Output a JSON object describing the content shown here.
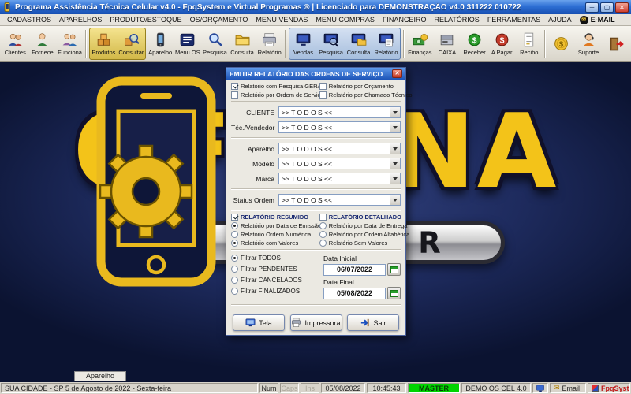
{
  "window": {
    "title": "Programa Assistência Técnica Celular v4.0 - FpqSystem e Virtual Programas ® | Licenciado para  DEMONSTRAÇÃO v4.0 311222 010722",
    "controls": {
      "minimize": "─",
      "maximize": "▢",
      "close": "✕"
    }
  },
  "menubar": {
    "items": [
      "CADASTROS",
      "APARELHOS",
      "PRODUTO/ESTOQUE",
      "OS/ORÇAMENTO",
      "MENU VENDAS",
      "MENU COMPRAS",
      "FINANCEIRO",
      "RELATÓRIOS",
      "FERRAMENTAS",
      "AJUDA"
    ],
    "email": {
      "label": "E-MAIL",
      "glyph": "✉"
    }
  },
  "toolbar": {
    "buttons": [
      {
        "label": "Clientes",
        "icon": "clients-icon"
      },
      {
        "label": "Fornece",
        "icon": "suppliers-icon"
      },
      {
        "label": "Funciona",
        "icon": "employees-icon"
      },
      {
        "label": "Produtos",
        "icon": "products-icon"
      },
      {
        "label": "Consultar",
        "icon": "products-search-icon"
      },
      {
        "label": "Aparelho",
        "icon": "device-icon"
      },
      {
        "label": "Menu OS",
        "icon": "service-orders-icon"
      },
      {
        "label": "Pesquisa",
        "icon": "os-search-icon"
      },
      {
        "label": "Consulta",
        "icon": "os-query-icon"
      },
      {
        "label": "Relatório",
        "icon": "os-report-icon"
      },
      {
        "label": "Vendas",
        "icon": "sales-icon"
      },
      {
        "label": "Pesquisa",
        "icon": "sales-search-icon"
      },
      {
        "label": "Consulta",
        "icon": "sales-query-icon"
      },
      {
        "label": "Relatório",
        "icon": "sales-report-icon"
      },
      {
        "label": "Finanças",
        "icon": "finance-icon"
      },
      {
        "label": "CAIXA",
        "icon": "cashbox-icon"
      },
      {
        "label": "Receber",
        "icon": "receivables-icon"
      },
      {
        "label": "A Pagar",
        "icon": "payables-icon"
      },
      {
        "label": "Recibo",
        "icon": "receipt-icon"
      },
      {
        "label": "",
        "icon": "coins-icon"
      },
      {
        "label": "Suporte",
        "icon": "support-icon"
      },
      {
        "label": "",
        "icon": "exit-icon"
      }
    ]
  },
  "brand": {
    "top": "OFICINA",
    "bottom": "CELULAR"
  },
  "floating_label": "Aparelho",
  "dialog": {
    "title": "EMITIR RELATÓRIO DAS ORDENS DE SERVIÇO",
    "close_glyph": "✕",
    "checkboxes": {
      "pesquisa_geral": {
        "label": "Relatório com Pesquisa GERAL",
        "checked": true
      },
      "por_orcamento": {
        "label": "Relatório por Orçamento",
        "checked": false
      },
      "por_ordem_servico": {
        "label": "Relatório por Ordem de Serviço",
        "checked": false
      },
      "por_chamado_tecnico": {
        "label": "Relatório por Chamado Técnico",
        "checked": false
      },
      "resumido": {
        "label": "RELATÓRIO RESUMIDO",
        "checked": true
      },
      "detalhado": {
        "label": "RELATÓRIO DETALHADO",
        "checked": false
      }
    },
    "selects": {
      "cliente": {
        "label": "CLIENTE",
        "value": ">> T O D O S <<"
      },
      "tecnico": {
        "label": "Téc./Vendedor",
        "value": ">> T O D O S <<"
      },
      "aparelho": {
        "label": "Aparelho",
        "value": ">> T O D O S <<"
      },
      "modelo": {
        "label": "Modelo",
        "value": ">> T O D O S <<"
      },
      "marca": {
        "label": "Marca",
        "value": ">> T O D O S <<"
      },
      "status_ordem": {
        "label": "Status Ordem",
        "value": ">> T O D O S <<"
      }
    },
    "radios": {
      "data_emissao": {
        "label": "Relatório por Data de Emissão",
        "selected": true
      },
      "data_entrega": {
        "label": "Relatório por Data de Entrega",
        "selected": false
      },
      "ordem_numerica": {
        "label": "Relatório Ordem Numérica",
        "selected": false
      },
      "ordem_alfabetica": {
        "label": "Relatório por Ordem Alfabética",
        "selected": false
      },
      "com_valores": {
        "label": "Relatório com Valores",
        "selected": true
      },
      "sem_valores": {
        "label": "Relatório Sem Valores",
        "selected": false
      },
      "filtrar_todos": {
        "label": "Filtrar TODOS",
        "selected": true
      },
      "filtrar_pendentes": {
        "label": "Filtrar PENDENTES",
        "selected": false
      },
      "filtrar_cancelados": {
        "label": "Filtrar CANCELADOS",
        "selected": false
      },
      "filtrar_finalizados": {
        "label": "Filtrar FINALIZADOS",
        "selected": false
      }
    },
    "dates": {
      "inicial": {
        "label": "Data Inicial",
        "value": "06/07/2022"
      },
      "final": {
        "label": "Data Final",
        "value": "05/08/2022"
      }
    },
    "buttons": {
      "tela": "Tela",
      "impressora": "Impressora",
      "sair": "Sair"
    }
  },
  "statusbar": {
    "location": "SUA CIDADE - SP  5 de Agosto de 2022 - Sexta-feira",
    "num": "Num",
    "caps": "Caps",
    "ins": "Ins",
    "date": "05/08/2022",
    "time": "10:45:43",
    "user": "MASTER",
    "product": "DEMO OS CEL 4.0",
    "email": "Email",
    "brand": "FpqSystem"
  },
  "colors": {
    "accent": "#1d55b8",
    "gold": "#f3c319",
    "status_green": "#00d400",
    "close_red": "#cf4030"
  }
}
